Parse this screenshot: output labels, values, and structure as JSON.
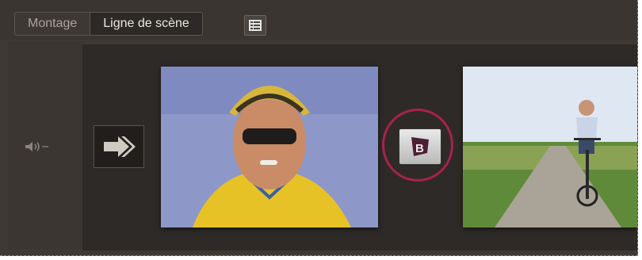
{
  "tabs": [
    {
      "label": "Montage",
      "active": false
    },
    {
      "label": "Ligne de scène",
      "active": true
    }
  ],
  "icons": {
    "list_view": "list-view-icon",
    "audio": "audio-speaker-icon",
    "transition": "transition-arrow-icon",
    "title": "add-title-icon"
  },
  "colors": {
    "panel": "#3e3935",
    "timeline": "#2e2a27",
    "highlight": "#a8214f"
  },
  "clips": [
    {
      "subject": "child-with-helmet"
    },
    {
      "subject": "child-on-bike"
    }
  ]
}
